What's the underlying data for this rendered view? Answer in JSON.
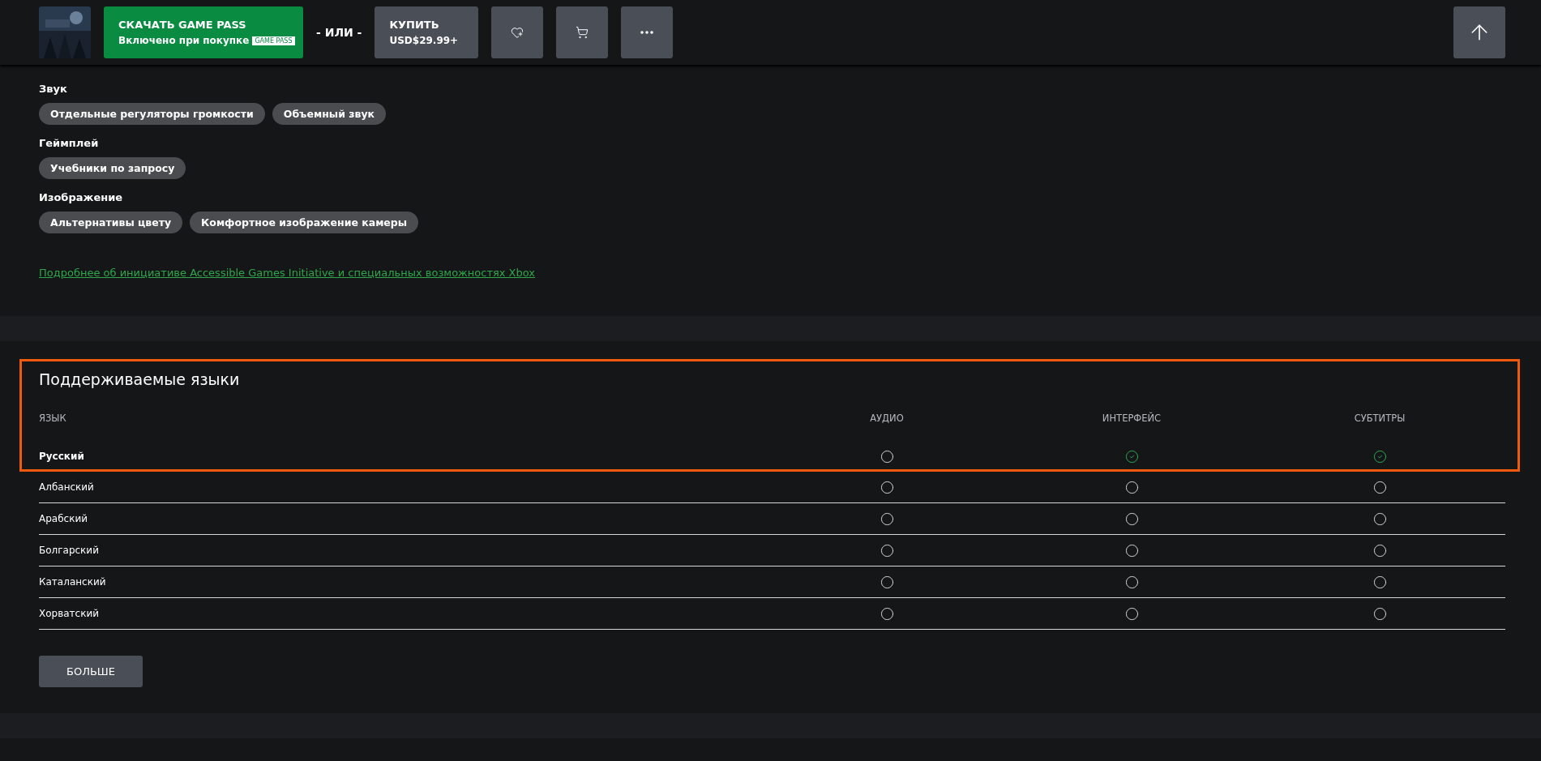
{
  "header": {
    "download_button": {
      "title": "СКАЧАТЬ GAME PASS",
      "subtitle": "Включено при покупке",
      "badge": "GAME PASS"
    },
    "separator": "- ИЛИ -",
    "buy_button": {
      "title": "КУПИТЬ",
      "price": "USD$29.99+"
    }
  },
  "accessibility": {
    "groups": [
      {
        "heading": "Звук",
        "features": [
          "Отдельные регуляторы громкости",
          "Объемный звук"
        ]
      },
      {
        "heading": "Геймплей",
        "features": [
          "Учебники по запросу"
        ]
      },
      {
        "heading": "Изображение",
        "features": [
          "Альтернативы цвету",
          "Комфортное изображение камеры"
        ]
      }
    ],
    "link": "Подробнее об инициативе Accessible Games Initiative и специальных возможностях Xbox"
  },
  "languages": {
    "title": "Поддерживаемые языки",
    "highlighted": true,
    "columns": [
      "ЯЗЫК",
      "АУДИО",
      "ИНТЕРФЕЙС",
      "СУБТИТРЫ"
    ],
    "rows": [
      {
        "name": "Русский",
        "current": true,
        "support": [
          false,
          true,
          true
        ]
      },
      {
        "name": "Албанский",
        "current": false,
        "support": [
          false,
          false,
          false
        ]
      },
      {
        "name": "Арабский",
        "current": false,
        "support": [
          false,
          false,
          false
        ]
      },
      {
        "name": "Болгарский",
        "current": false,
        "support": [
          false,
          false,
          false
        ]
      },
      {
        "name": "Каталанский",
        "current": false,
        "support": [
          false,
          false,
          false
        ]
      },
      {
        "name": "Хорватский",
        "current": false,
        "support": [
          false,
          false,
          false
        ]
      }
    ],
    "more_button": "БОЛЬШЕ"
  }
}
